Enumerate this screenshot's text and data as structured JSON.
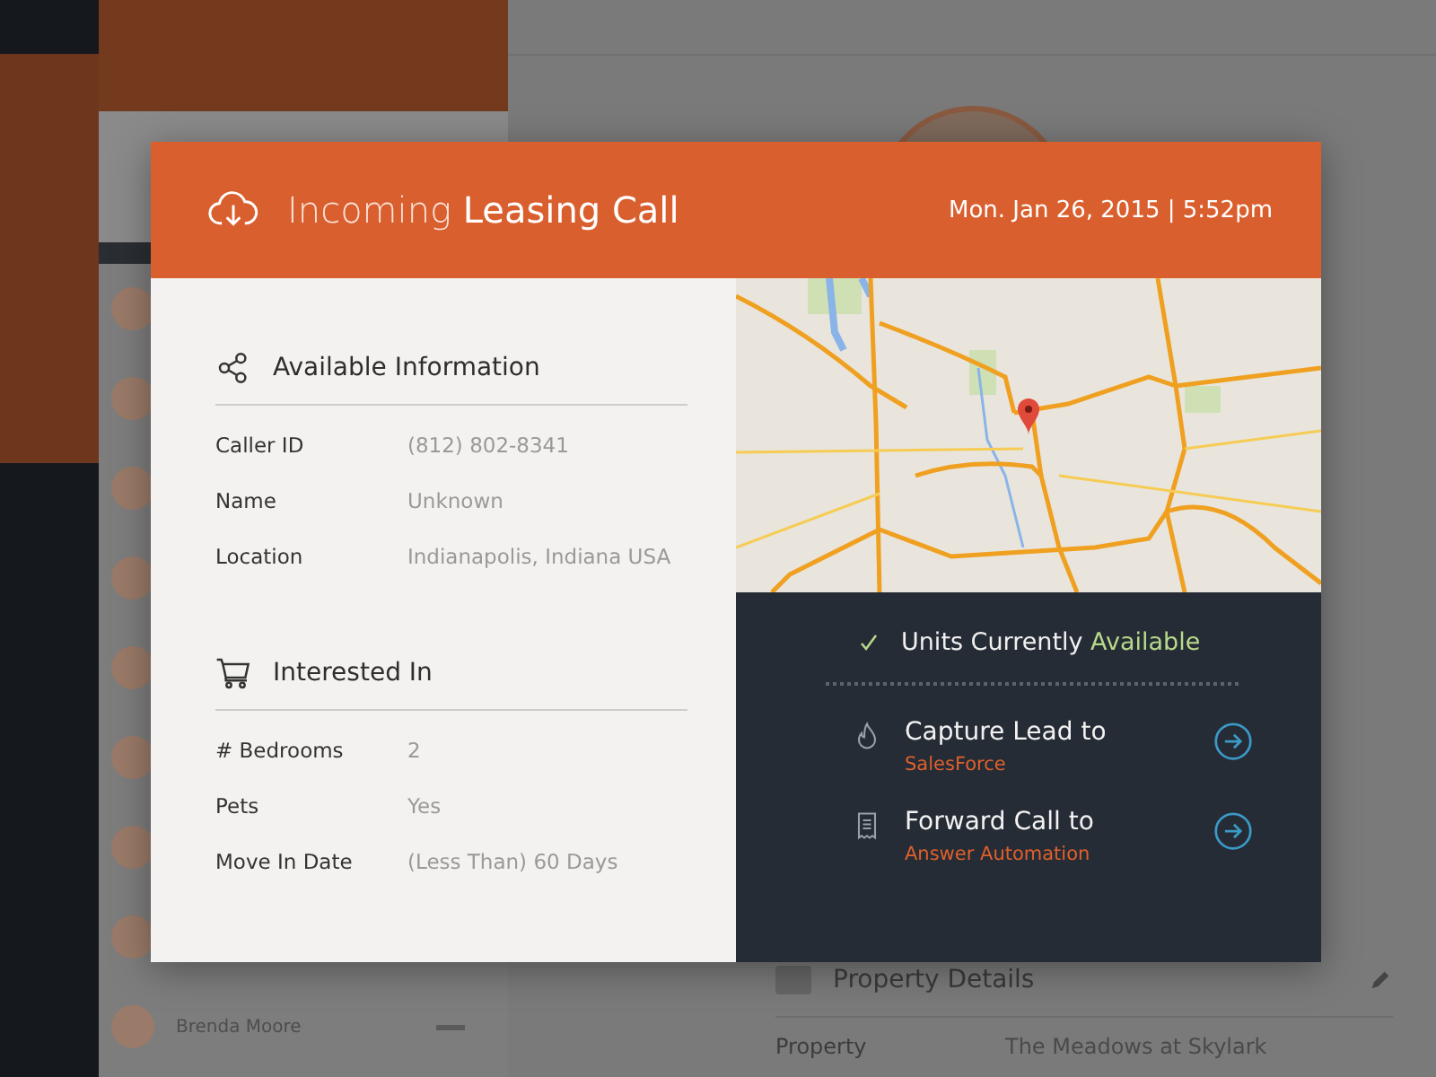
{
  "background": {
    "contacts": [
      {
        "name": "Brenda Moore"
      }
    ],
    "details": {
      "section": "Property Details",
      "fields": [
        {
          "label": "Property",
          "value": "The Meadows at Skylark"
        }
      ]
    }
  },
  "dialog": {
    "title": "Incoming **Leasing Call**",
    "datetime": "Mon. Jan 26, 2015 | 5:52pm",
    "sections": [
      {
        "kind": "share",
        "heading": "Available Information",
        "rows": [
          {
            "label": "Caller ID",
            "value": "(812) 802-8341"
          },
          {
            "label": "Name",
            "value": "Unknown"
          },
          {
            "label": "Location",
            "value": "Indianapolis, Indiana USA"
          }
        ]
      },
      {
        "kind": "cart",
        "heading": "Interested In",
        "rows": [
          {
            "label": "# Bedrooms",
            "value": "2"
          },
          {
            "label": "Pets",
            "value": "Yes"
          },
          {
            "label": "Move In Date",
            "value": "(Less Than) 60 Days"
          }
        ]
      }
    ],
    "status": {
      "text": "Units Currently",
      "highlight": "Available"
    },
    "actions": [
      {
        "kind": "flame",
        "title": "Capture Lead to",
        "target": "SalesForce"
      },
      {
        "kind": "receipt",
        "title": "Forward Call to",
        "target": "Answer Automation"
      }
    ]
  }
}
